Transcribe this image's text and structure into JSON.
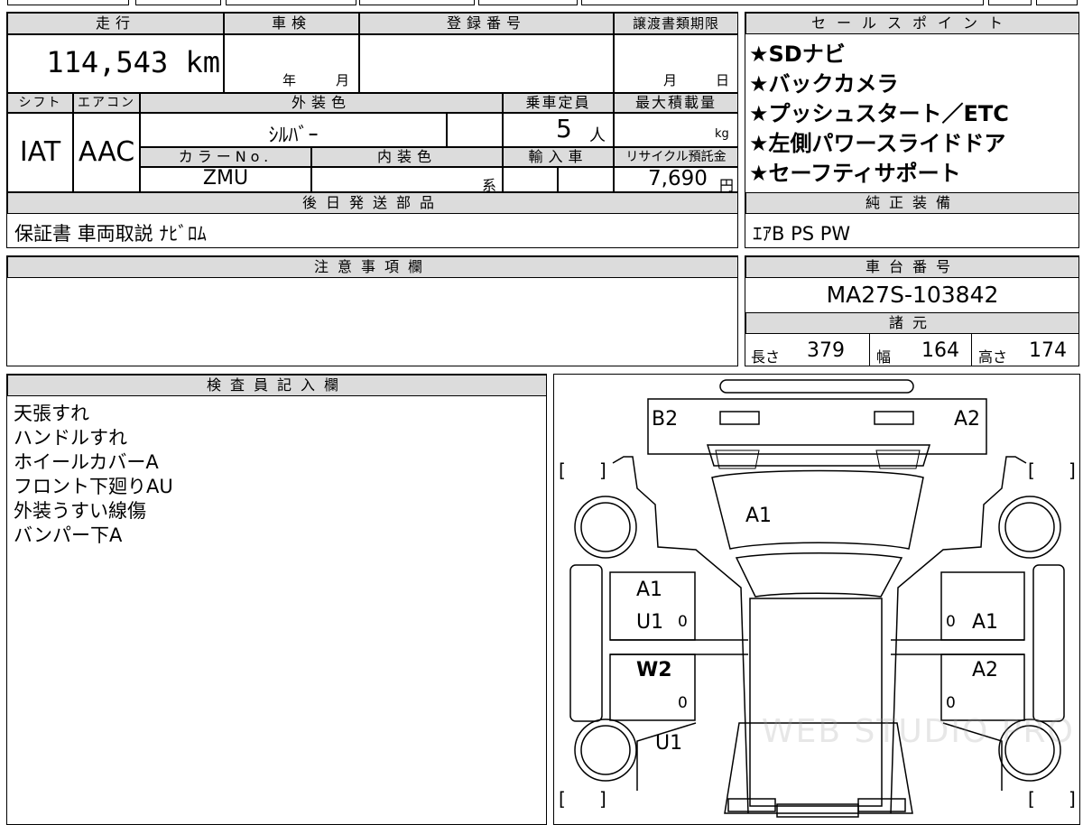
{
  "top": {
    "mileage_header": "走行",
    "inspection_header": "車検",
    "registration_header": "登録番号",
    "transfer_deadline_header": "譲渡書類期限",
    "mileage_value": "114,543 km",
    "year_label": "年",
    "month_label": "月",
    "deadline_month_label": "月",
    "deadline_day_label": "日"
  },
  "specs": {
    "shift_header": "シフト",
    "aircon_header": "エアコン",
    "exterior_color_header": "外装色",
    "capacity_header": "乗車定員",
    "max_load_header": "最大積載量",
    "shift_value": "IAT",
    "aircon_value": "AAC",
    "exterior_color_value": "ｼﾙﾊﾞｰ",
    "capacity_value": "5",
    "capacity_unit": "人",
    "load_unit": "kg",
    "color_no_header": "カラーNo.",
    "interior_color_header": "内装色",
    "import_header": "輸入車",
    "recycle_header": "リサイクル預託金",
    "color_no_value": "ZMU",
    "interior_suffix": "系",
    "recycle_value": "7,690",
    "recycle_unit": "円"
  },
  "later_parts": {
    "header": "後日発送部品",
    "value": "保証書 車両取説 ﾅﾋﾞﾛﾑ"
  },
  "sales_points": {
    "header": "セールスポイント",
    "items": [
      "★SDナビ",
      "★バックカメラ",
      "★プッシュスタート／ETC",
      "★左側パワースライドドア",
      "★セーフティサポート"
    ]
  },
  "genuine_equipment": {
    "header": "純正装備",
    "value": "ｴｱB PS PW"
  },
  "caution": {
    "header": "注意事項欄"
  },
  "chassis": {
    "header": "車台番号",
    "value": "MA27S-103842"
  },
  "dimensions": {
    "header": "諸元",
    "length_label": "長さ",
    "length_value": "379",
    "width_label": "幅",
    "width_value": "164",
    "height_label": "高さ",
    "height_value": "174"
  },
  "inspector": {
    "header": "検査員記入欄",
    "notes": [
      "天張すれ",
      "ハンドルすれ",
      "ホイールカバーA",
      "フロント下廻りAU",
      "外装うすい線傷",
      "バンパー下A"
    ]
  },
  "damage_map": {
    "rear_left": "B2",
    "rear_right": "A2",
    "glass": "A1",
    "left_front_door": "A1",
    "left_front_door_2": "U1",
    "left_rear_door": "W2",
    "left_rear_fender": "U1",
    "right_front_door": "A1",
    "right_rear_door": "A2",
    "zero_mark": "0",
    "bracket_open": "[",
    "bracket_close": "]",
    "watermark": "WEB STUDIO PRO"
  }
}
